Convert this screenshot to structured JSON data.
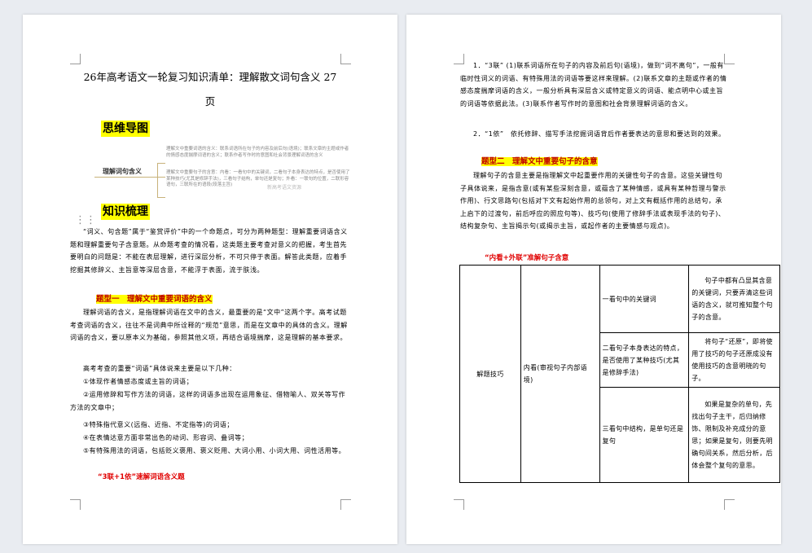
{
  "left_page": {
    "title": "26年高考语文一轮复习知识清单：理解散文词句含义 27页",
    "mindmap_heading": "思维导图",
    "mindmap": {
      "root": "理解词句含义",
      "branch1": "理解文中重要词语的含义：联系词语所在句子的内容及前后句(语境)；联系文章的主题或作者的情感态度揣摩词语的含义；联系作者写作时的意图和社会背景理解词语的含义",
      "branch2": "理解文中重要句子的含意：内看：一看句中的关键词，二看句子本身表达的特点，是否使用了某种技巧(尤其是修辞手法)，三看句子结构，单句还是复句；外看：一联句的位置，二联形容语句，三联所在的语段(段落主旨)",
      "watermark": "新高考语文资源"
    },
    "knowledge_heading": "知识梳理",
    "intro": "“词义、句含题”属于“鉴赏评价”中的一个命题点，可分为两种题型：理解重要词语含义题和理解重要句子含意题。从命题考查的情况看，这类题主要考查对意义的把握，考生首先要明白的问题是：不能在表层理解，进行深层分析，不可只停于表面。解答此类题，应着手挖掘其修辞义、主旨意等深层含意，不能浮于表面，流于肤浅。",
    "type1_heading": "题型一　理解文中重要词语的含义",
    "type1_p1": "理解词语的含义，是指理解词语在文中的含义，最重要的是“文中”这两个字。高考试题考查词语的含义，往往不是词典中所诠释的“规范”意思，而是在文章中的具体的含义。理解词语的含义，要以原本义为基础，参照其他义项，再结合语境揣摩，这是理解的基本要求。",
    "type1_p2": "高考考查的重要“词语”具体说来主要是以下几种：",
    "items": [
      "①体现作者情感态度或主旨的词语；",
      "②运用修辞和写作方法的词语，这样的词语多出现在运用象征、借物喻人、双关等写作方法的文章中；",
      "③特殊指代意义(远指、近指、不定指等)的词语；",
      "④在表情达意方面非常出色的动词、形容词、叠词等；",
      "⑤有特殊用法的词语，包括贬义褒用、褒义贬用、大词小用、小词大用、词性活用等。"
    ],
    "red_sub": "“3联+1依”速解词语含义题"
  },
  "right_page": {
    "p1": "1．“3联” (1)联系词语所在句子的内容及前后句(语境)，做到“词不离句”，一般有临时性词义的词语、有特殊用法的词语等要这样来理解。(2)联系文章的主题或作者的情感态度揣摩词语的含义，一般分析具有深层含义或特定意义的词语、能点明中心或主旨的词语等依据此法。(3)联系作者写作时的意图和社会背景理解词语的含义。",
    "p2": "2．“1依”　依托修辞、描写手法挖掘词语背后作者要表达的意思和要达到的效果。",
    "type2_heading": "题型二　理解文中重要句子的含意",
    "type2_p1": "理解句子的含意主要是指理解文中起重要作用的关键性句子的含意。这些关键性句子具体说来，是指含意(或有某些深刻含意，或蕴含了某种情感，或具有某种哲理与警示作用)、行文思路句(包括对下文有起始作用的总领句，对上文有概括作用的总结句，承上启下的过渡句，前后呼应的照应句等)、技巧句(使用了修辞手法或表现手法的句子)、结构复杂句、主旨揭示句(或揭示主旨，或起作者的主要情感与观点)。",
    "red_sub": "“内看+外联”准解句子含意",
    "table": {
      "col1": "解题技巧",
      "col2": "内看(审视句子内部语境)",
      "rows": [
        {
          "method": "一看句中的关键词",
          "desc": "句子中都有凸显其含意的关键词，只要弄清这些词语的含义，就可推知整个句子的含意。"
        },
        {
          "method": "二看句子本身表达的特点，是否使用了某种技巧(尤其是修辞手法)",
          "desc": "将句子“还原”，即将使用了技巧的句子还原成没有使用技巧的含意明晓的句子。"
        },
        {
          "method": "三看句中结构，是单句还是复句",
          "desc": "如果是复杂的单句，先找出句子主干，后归纳修饰、限制及补充成分的意思；如果是复句，则要先明确句间关系，然后分析，后体会整个复句的意思。"
        }
      ]
    }
  },
  "colors": {
    "highlight": "#ffff00",
    "heading_red": "#c00000",
    "sub_red": "#e00000",
    "background": "#e9ecf1"
  }
}
